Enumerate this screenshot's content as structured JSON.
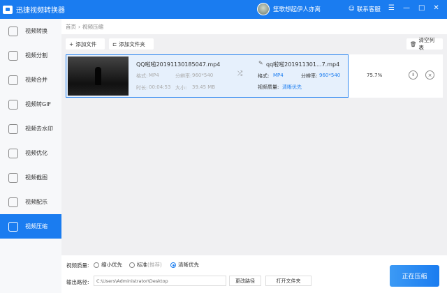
{
  "app": {
    "title": "迅捷视频转换器",
    "user": "笙歌想起伊人亦离",
    "support": "联系客服"
  },
  "sidebar": {
    "items": [
      {
        "label": "视频转换"
      },
      {
        "label": "视频分割"
      },
      {
        "label": "视频合并"
      },
      {
        "label": "视频转GIF"
      },
      {
        "label": "视频去水印"
      },
      {
        "label": "视频优化"
      },
      {
        "label": "视频截图"
      },
      {
        "label": "视频配乐"
      },
      {
        "label": "视频压缩",
        "active": true
      }
    ]
  },
  "breadcrumb": {
    "home": "首页",
    "sep": "›",
    "current": "视频压缩"
  },
  "toolbar": {
    "add_file": "添加文件",
    "add_folder": "添加文件夹",
    "clear": "清空列表"
  },
  "file": {
    "name": "QQ啦啦20191130185047.mp4",
    "format_label": "格式:",
    "format": "MP4",
    "res_label": "分辨率:",
    "res": "960*540",
    "duration_label": "时长:",
    "duration": "00:04:53",
    "size_label": "大小:",
    "size": "39.45 MB",
    "out_name": "qq啦啦201911301...7.mp4",
    "out_format": "MP4",
    "out_res": "960*540",
    "quality_label": "视频质量:",
    "quality": "清晰优先",
    "progress": "75.7%"
  },
  "bottom": {
    "quality_label": "视频质量:",
    "options": [
      "缩小优先",
      "标准",
      "清晰优先"
    ],
    "recommend": "(推荐)",
    "selected": 2,
    "path_label": "输出路径:",
    "path": "C:\\Users\\Administrator\\Desktop",
    "change_path": "更改路径",
    "open_folder": "打开文件夹",
    "start": "正在压缩"
  },
  "colors": {
    "accent": "#1a7cf0"
  }
}
